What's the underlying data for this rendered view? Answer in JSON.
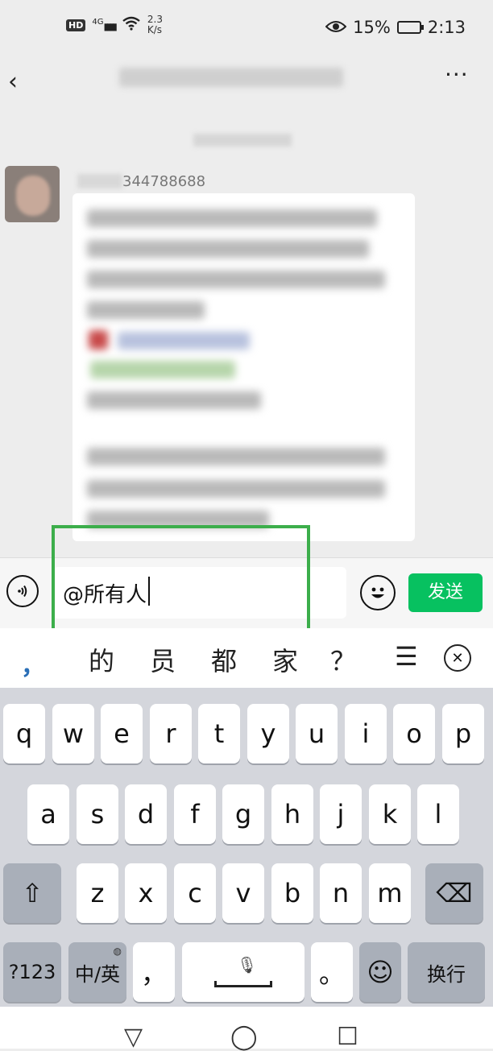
{
  "status_bar": {
    "hd": "HD",
    "network": "4G",
    "signal_glyph": "▮▮▮▮",
    "speed_value": "2.3",
    "speed_unit": "K/s",
    "battery": "15%",
    "time": "2:13",
    "icons": [
      "hd-icon",
      "signal-icon",
      "wifi-icon",
      "eye-icon",
      "battery-icon"
    ]
  },
  "chat_header": {
    "back_glyph": "‹",
    "more_glyph": "···"
  },
  "message": {
    "sender_visible": "344788688"
  },
  "input": {
    "value": "@所有人",
    "send_label": "发送"
  },
  "candidates": [
    "的",
    "员",
    "都",
    "家",
    "？"
  ],
  "candidate_comma": "，",
  "candidate_more_glyph": "☰",
  "keyboard": {
    "row1": [
      "q",
      "w",
      "e",
      "r",
      "t",
      "y",
      "u",
      "i",
      "o",
      "p"
    ],
    "row2": [
      "a",
      "s",
      "d",
      "f",
      "g",
      "h",
      "j",
      "k",
      "l"
    ],
    "row3": [
      "z",
      "x",
      "c",
      "v",
      "b",
      "n",
      "m"
    ],
    "shift_glyph": "⇧",
    "delete_glyph": "⌫",
    "num_label": "?123",
    "lang_label": "中/英",
    "comma_label": "，",
    "period_label": "。",
    "emoji_glyph": "☺",
    "enter_label": "换行"
  },
  "nav": {
    "back_glyph": "▽",
    "home_glyph": "◯",
    "recent_glyph": "☐"
  }
}
